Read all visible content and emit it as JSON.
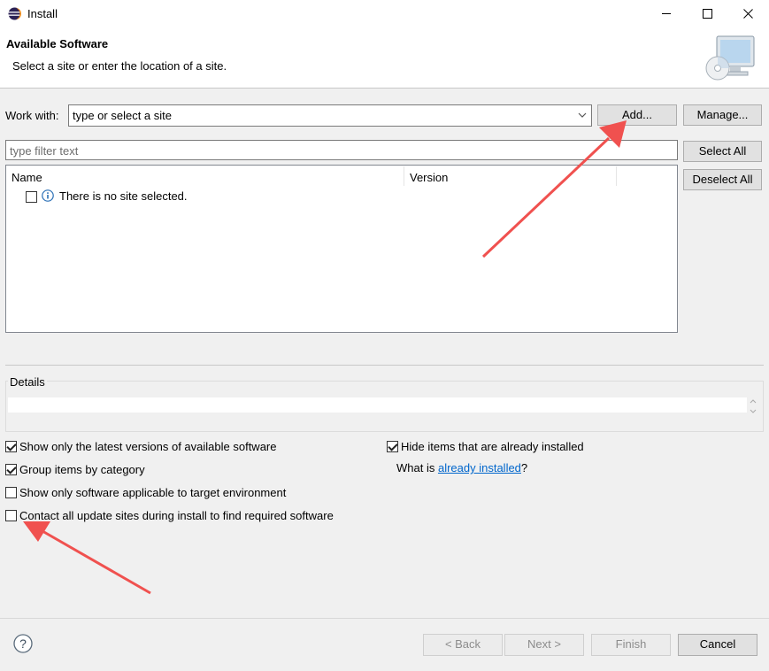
{
  "window": {
    "title": "Install"
  },
  "header": {
    "title": "Available Software",
    "subtitle": "Select a site or enter the location of a site."
  },
  "work_with": {
    "label": "Work with:",
    "value": "type or select a site",
    "add_label": "Add...",
    "manage_label": "Manage..."
  },
  "filter": {
    "placeholder": "type filter text"
  },
  "side_buttons": {
    "select_all": "Select All",
    "deselect_all": "Deselect All"
  },
  "table": {
    "columns": [
      "Name",
      "Version"
    ],
    "rows": [
      {
        "text": "There is no site selected.",
        "checked": false
      }
    ]
  },
  "details": {
    "label": "Details"
  },
  "options": {
    "show_latest": {
      "label": "Show only the latest versions of available software",
      "checked": true
    },
    "group_by_category": {
      "label": "Group items by category",
      "checked": true
    },
    "show_applicable": {
      "label": "Show only software applicable to target environment",
      "checked": false
    },
    "contact_sites": {
      "label": "Contact all update sites during install to find required software",
      "checked": false
    },
    "hide_installed": {
      "label": "Hide items that are already installed",
      "checked": true
    },
    "what_is_prefix": "What is ",
    "what_is_link": "already installed",
    "what_is_suffix": "?"
  },
  "footer": {
    "back": "< Back",
    "next": "Next >",
    "finish": "Finish",
    "cancel": "Cancel"
  },
  "colors": {
    "annotation_arrow": "#f0514f",
    "link": "#0066cc",
    "focus": "#0078d7"
  }
}
